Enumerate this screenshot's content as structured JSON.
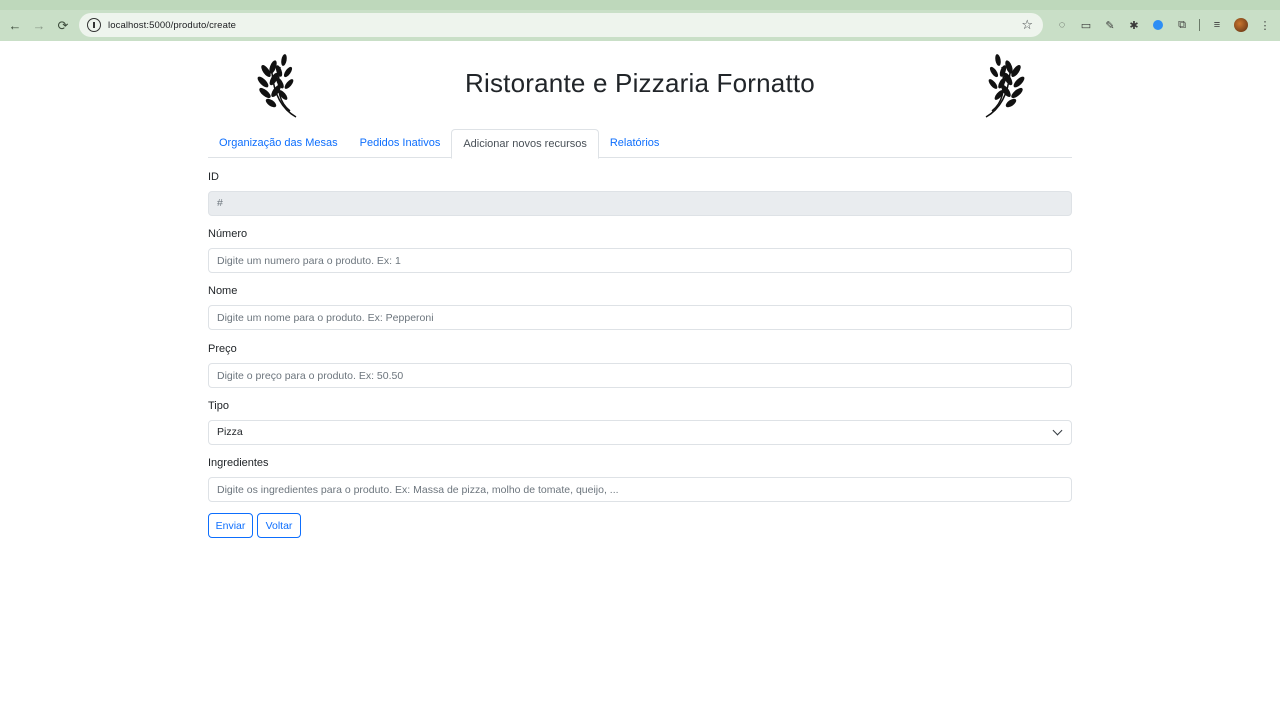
{
  "browser": {
    "url": "localhost:5000/produto/create"
  },
  "header": {
    "title": "Ristorante e Pizzaria Fornatto"
  },
  "tabs": [
    {
      "label": "Organização das Mesas",
      "active": false
    },
    {
      "label": "Pedidos Inativos",
      "active": false
    },
    {
      "label": "Adicionar novos recursos",
      "active": true
    },
    {
      "label": "Relatórios",
      "active": false
    }
  ],
  "form": {
    "id": {
      "label": "ID",
      "value": "#"
    },
    "numero": {
      "label": "Número",
      "placeholder": "Digite um numero para o produto. Ex: 1"
    },
    "nome": {
      "label": "Nome",
      "placeholder": "Digite um nome para o produto. Ex: Pepperoni"
    },
    "preco": {
      "label": "Preço",
      "placeholder": "Digite o preço para o produto. Ex: 50.50"
    },
    "tipo": {
      "label": "Tipo",
      "selected": "Pizza"
    },
    "ingredientes": {
      "label": "Ingredientes",
      "placeholder": "Digite os ingredientes para o produto. Ex: Massa de pizza, molho de tomate, queijo, ..."
    },
    "submit_label": "Enviar",
    "back_label": "Voltar"
  },
  "colors": {
    "link": "#0d6efd",
    "browser_bar": "#c9dfc7"
  }
}
